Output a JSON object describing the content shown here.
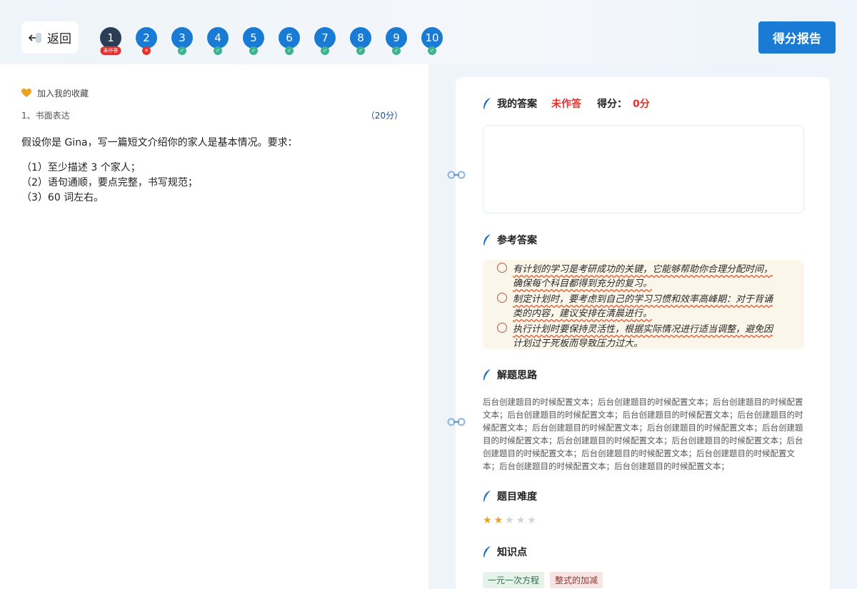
{
  "header": {
    "back_label": "返回",
    "report_label": "得分报告",
    "accent": "#1a7bd4",
    "steps": [
      {
        "num": "1",
        "state": "current",
        "badge": "未作答"
      },
      {
        "num": "2",
        "state": "wrong",
        "badge": "✕"
      },
      {
        "num": "3",
        "state": "right",
        "badge": "✓"
      },
      {
        "num": "4",
        "state": "right",
        "badge": "✓"
      },
      {
        "num": "5",
        "state": "right",
        "badge": "✓"
      },
      {
        "num": "6",
        "state": "right",
        "badge": "✓"
      },
      {
        "num": "7",
        "state": "right",
        "badge": "✓"
      },
      {
        "num": "8",
        "state": "right",
        "badge": "✓"
      },
      {
        "num": "9",
        "state": "right",
        "badge": "✓"
      },
      {
        "num": "10",
        "state": "right",
        "badge": "✓"
      }
    ]
  },
  "question": {
    "favorite_label": "加入我的收藏",
    "type_label": "1、书面表达",
    "score_label": "（20分）",
    "lead": "假设你是 Gina，写一篇短文介绍你的家人是基本情况。要求：",
    "requirements": [
      "（1）至少描述 3 个家人；",
      "（2）语句通顺，要点完整，书写规范；",
      "（3）60 词左右。"
    ]
  },
  "answer_panel": {
    "my_answer_title": "我的答案",
    "my_answer_status": "未作答",
    "score_title": "得分：",
    "score_value": "0分",
    "reference_title": "参考答案",
    "reference_lines": [
      "有计划的学习是考研成功的关键，它能够帮助你合理分配时间，",
      "确保每个科目都得到充分的复习。",
      "制定计划时，要考虑到自己的学习习惯和效率高峰期：对于背诵",
      "类的内容，建议安排在清晨进行。",
      "执行计划时要保持灵活性，根据实际情况进行适当调整，避免因",
      "计划过于死板而导致压力过大。"
    ],
    "thinking_title": "解题思路",
    "thinking_text": "后台创建题目的时候配置文本；后台创建题目的时候配置文本；后台创建题目的时候配置文本；后台创建题目的时候配置文本；后台创建题目的时候配置文本；后台创建题目的时候配置文本；后台创建题目的时候配置文本；后台创建题目的时候配置文本；后台创建题目的时候配置文本；后台创建题目的时候配置文本；后台创建题目的时候配置文本；后台创建题目的时候配置文本；后台创建题目的时候配置文本；后台创建题目的时候配置文本；后台创建题目的时候配置文本；后台创建题目的时候配置文本；",
    "difficulty_title": "题目难度",
    "difficulty_stars": 2,
    "difficulty_max": 5,
    "knowledge_title": "知识点",
    "tags": [
      "一元一次方程",
      "整式的加减"
    ]
  }
}
